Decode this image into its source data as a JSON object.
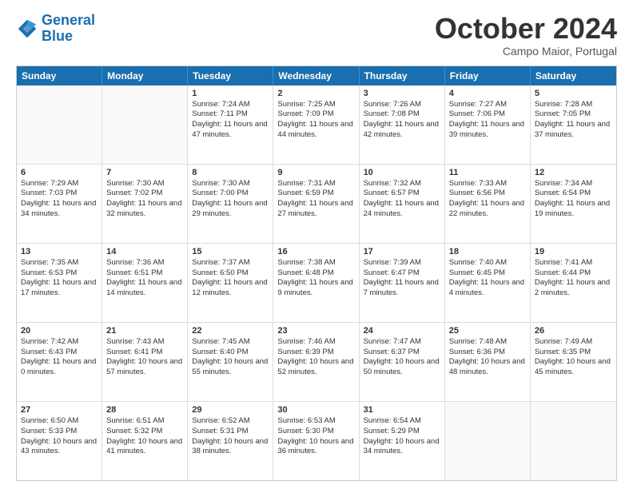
{
  "logo": {
    "line1": "General",
    "line2": "Blue"
  },
  "title": "October 2024",
  "location": "Campo Maior, Portugal",
  "header_days": [
    "Sunday",
    "Monday",
    "Tuesday",
    "Wednesday",
    "Thursday",
    "Friday",
    "Saturday"
  ],
  "weeks": [
    [
      {
        "day": "",
        "info": ""
      },
      {
        "day": "",
        "info": ""
      },
      {
        "day": "1",
        "info": "Sunrise: 7:24 AM\nSunset: 7:11 PM\nDaylight: 11 hours and 47 minutes."
      },
      {
        "day": "2",
        "info": "Sunrise: 7:25 AM\nSunset: 7:09 PM\nDaylight: 11 hours and 44 minutes."
      },
      {
        "day": "3",
        "info": "Sunrise: 7:26 AM\nSunset: 7:08 PM\nDaylight: 11 hours and 42 minutes."
      },
      {
        "day": "4",
        "info": "Sunrise: 7:27 AM\nSunset: 7:06 PM\nDaylight: 11 hours and 39 minutes."
      },
      {
        "day": "5",
        "info": "Sunrise: 7:28 AM\nSunset: 7:05 PM\nDaylight: 11 hours and 37 minutes."
      }
    ],
    [
      {
        "day": "6",
        "info": "Sunrise: 7:29 AM\nSunset: 7:03 PM\nDaylight: 11 hours and 34 minutes."
      },
      {
        "day": "7",
        "info": "Sunrise: 7:30 AM\nSunset: 7:02 PM\nDaylight: 11 hours and 32 minutes."
      },
      {
        "day": "8",
        "info": "Sunrise: 7:30 AM\nSunset: 7:00 PM\nDaylight: 11 hours and 29 minutes."
      },
      {
        "day": "9",
        "info": "Sunrise: 7:31 AM\nSunset: 6:59 PM\nDaylight: 11 hours and 27 minutes."
      },
      {
        "day": "10",
        "info": "Sunrise: 7:32 AM\nSunset: 6:57 PM\nDaylight: 11 hours and 24 minutes."
      },
      {
        "day": "11",
        "info": "Sunrise: 7:33 AM\nSunset: 6:56 PM\nDaylight: 11 hours and 22 minutes."
      },
      {
        "day": "12",
        "info": "Sunrise: 7:34 AM\nSunset: 6:54 PM\nDaylight: 11 hours and 19 minutes."
      }
    ],
    [
      {
        "day": "13",
        "info": "Sunrise: 7:35 AM\nSunset: 6:53 PM\nDaylight: 11 hours and 17 minutes."
      },
      {
        "day": "14",
        "info": "Sunrise: 7:36 AM\nSunset: 6:51 PM\nDaylight: 11 hours and 14 minutes."
      },
      {
        "day": "15",
        "info": "Sunrise: 7:37 AM\nSunset: 6:50 PM\nDaylight: 11 hours and 12 minutes."
      },
      {
        "day": "16",
        "info": "Sunrise: 7:38 AM\nSunset: 6:48 PM\nDaylight: 11 hours and 9 minutes."
      },
      {
        "day": "17",
        "info": "Sunrise: 7:39 AM\nSunset: 6:47 PM\nDaylight: 11 hours and 7 minutes."
      },
      {
        "day": "18",
        "info": "Sunrise: 7:40 AM\nSunset: 6:45 PM\nDaylight: 11 hours and 4 minutes."
      },
      {
        "day": "19",
        "info": "Sunrise: 7:41 AM\nSunset: 6:44 PM\nDaylight: 11 hours and 2 minutes."
      }
    ],
    [
      {
        "day": "20",
        "info": "Sunrise: 7:42 AM\nSunset: 6:43 PM\nDaylight: 11 hours and 0 minutes."
      },
      {
        "day": "21",
        "info": "Sunrise: 7:43 AM\nSunset: 6:41 PM\nDaylight: 10 hours and 57 minutes."
      },
      {
        "day": "22",
        "info": "Sunrise: 7:45 AM\nSunset: 6:40 PM\nDaylight: 10 hours and 55 minutes."
      },
      {
        "day": "23",
        "info": "Sunrise: 7:46 AM\nSunset: 6:39 PM\nDaylight: 10 hours and 52 minutes."
      },
      {
        "day": "24",
        "info": "Sunrise: 7:47 AM\nSunset: 6:37 PM\nDaylight: 10 hours and 50 minutes."
      },
      {
        "day": "25",
        "info": "Sunrise: 7:48 AM\nSunset: 6:36 PM\nDaylight: 10 hours and 48 minutes."
      },
      {
        "day": "26",
        "info": "Sunrise: 7:49 AM\nSunset: 6:35 PM\nDaylight: 10 hours and 45 minutes."
      }
    ],
    [
      {
        "day": "27",
        "info": "Sunrise: 6:50 AM\nSunset: 5:33 PM\nDaylight: 10 hours and 43 minutes."
      },
      {
        "day": "28",
        "info": "Sunrise: 6:51 AM\nSunset: 5:32 PM\nDaylight: 10 hours and 41 minutes."
      },
      {
        "day": "29",
        "info": "Sunrise: 6:52 AM\nSunset: 5:31 PM\nDaylight: 10 hours and 38 minutes."
      },
      {
        "day": "30",
        "info": "Sunrise: 6:53 AM\nSunset: 5:30 PM\nDaylight: 10 hours and 36 minutes."
      },
      {
        "day": "31",
        "info": "Sunrise: 6:54 AM\nSunset: 5:29 PM\nDaylight: 10 hours and 34 minutes."
      },
      {
        "day": "",
        "info": ""
      },
      {
        "day": "",
        "info": ""
      }
    ]
  ]
}
